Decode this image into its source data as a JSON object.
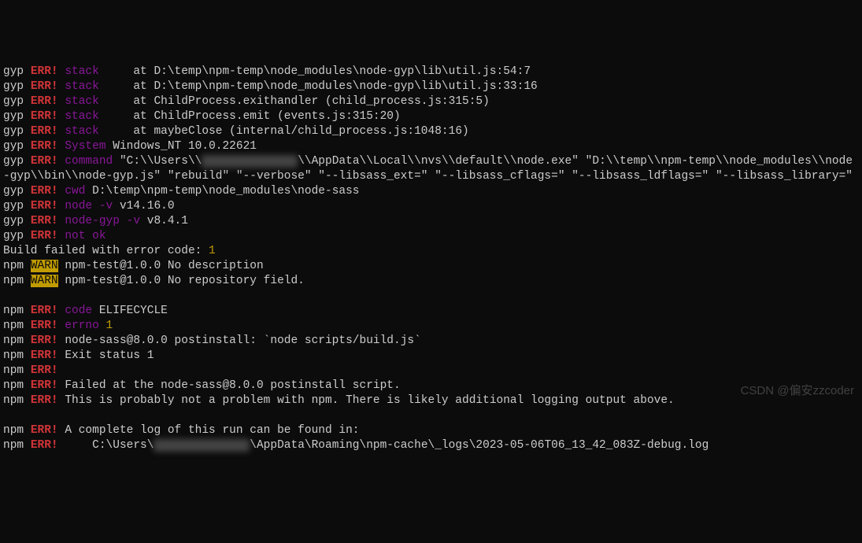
{
  "lines": [
    {
      "type": "gyp_err_stack",
      "text": "   at D:\\temp\\npm-temp\\node_modules\\node-gyp\\lib\\util.js:54:7"
    },
    {
      "type": "gyp_err_stack",
      "text": "   at D:\\temp\\npm-temp\\node_modules\\node-gyp\\lib\\util.js:33:16"
    },
    {
      "type": "gyp_err_stack",
      "text": "   at ChildProcess.exithandler (child_process.js:315:5)"
    },
    {
      "type": "gyp_err_stack",
      "text": "   at ChildProcess.emit (events.js:315:20)"
    },
    {
      "type": "gyp_err_stack",
      "text": "   at maybeClose (internal/child_process.js:1048:16)"
    },
    {
      "type": "gyp_err_kv",
      "key": "System",
      "value": "Windows_NT 10.0.22621"
    },
    {
      "type": "gyp_err_kv_obscured",
      "key": "command",
      "prefix": "\"C:\\\\Users\\\\",
      "obscured": "XXXXXXXXXXXXXX",
      "suffix": "\\\\AppData\\\\Local\\\\nvs\\\\default\\\\node.exe\" \"D:\\\\temp\\\\npm-temp\\\\node_modules\\\\node-gyp\\\\bin\\\\node-gyp.js\" \"rebuild\" \"--verbose\" \"--libsass_ext=\" \"--libsass_cflags=\" \"--libsass_ldflags=\" \"--libsass_library=\""
    },
    {
      "type": "gyp_err_kv",
      "key": "cwd",
      "value": "D:\\temp\\npm-temp\\node_modules\\node-sass"
    },
    {
      "type": "gyp_err_kv",
      "key": "node -v",
      "value": "v14.16.0"
    },
    {
      "type": "gyp_err_kv",
      "key": "node-gyp -v",
      "value": "v8.4.1"
    },
    {
      "type": "gyp_err_kv",
      "key": "not ok",
      "value": ""
    },
    {
      "type": "build_failed",
      "prefix": "Build failed with error code: ",
      "code": "1"
    },
    {
      "type": "npm_warn",
      "text": "npm-test@1.0.0 No description"
    },
    {
      "type": "npm_warn",
      "text": "npm-test@1.0.0 No repository field."
    },
    {
      "type": "blank"
    },
    {
      "type": "npm_err_kv",
      "key": "code",
      "value": "ELIFECYCLE"
    },
    {
      "type": "npm_err_kv_num",
      "key": "errno",
      "value": "1"
    },
    {
      "type": "npm_err",
      "text": "node-sass@8.0.0 postinstall: `node scripts/build.js`"
    },
    {
      "type": "npm_err",
      "text": "Exit status 1"
    },
    {
      "type": "npm_err",
      "text": ""
    },
    {
      "type": "npm_err",
      "text": "Failed at the node-sass@8.0.0 postinstall script."
    },
    {
      "type": "npm_err",
      "text": "This is probably not a problem with npm. There is likely additional logging output above."
    },
    {
      "type": "blank"
    },
    {
      "type": "npm_err",
      "text": "A complete log of this run can be found in:"
    },
    {
      "type": "npm_err_obscured",
      "prefix": "    C:\\Users\\",
      "obscured": "XXXXXXXXXXXXXX",
      "suffix": "\\AppData\\Roaming\\npm-cache\\_logs\\2023-05-06T06_13_42_083Z-debug.log"
    }
  ],
  "labels": {
    "gyp": "gyp",
    "npm": "npm",
    "err": "ERR!",
    "warn": "WARN",
    "stack": "stack"
  },
  "watermark": "CSDN @偏安zzcoder"
}
